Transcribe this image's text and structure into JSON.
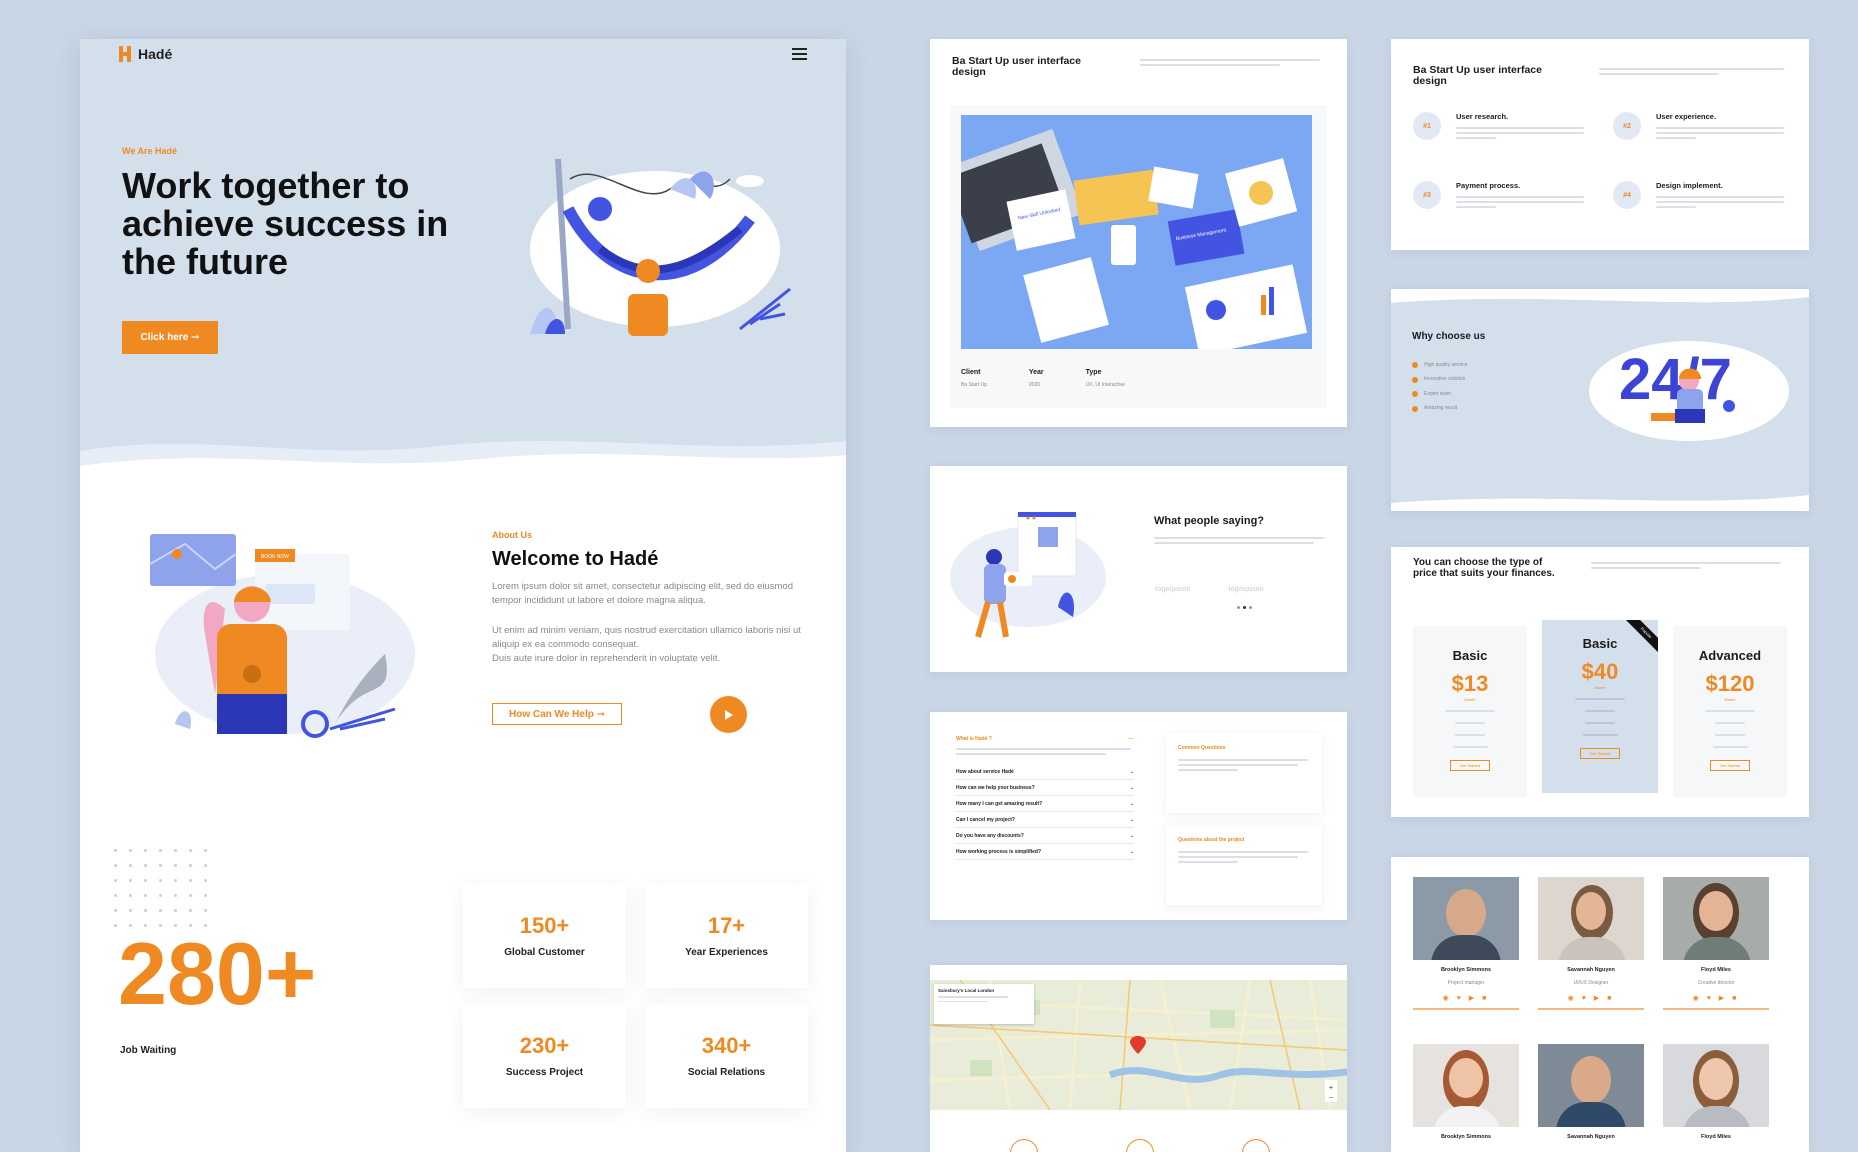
{
  "main": {
    "brand": "Hadé",
    "hero": {
      "eyebrow": "We Are Hadé",
      "title_lines": [
        "Work together to",
        "achieve success in",
        "the future"
      ],
      "cta": "Click here ➞"
    },
    "about": {
      "eyebrow": "About Us",
      "title": "Welcome to Hadé",
      "para1_lines": [
        "Lorem ipsum dolor sit amet, consectetur adipiscing elit, sed do eiusmod",
        "tempor incididunt ut labore et dolore magna aliqua."
      ],
      "para2_lines": [
        "Ut enim ad minim veniam, quis nostrud exercitation ullamco laboris nisi ut",
        "aliquip ex ea commodo consequat.",
        "Duis aute irure dolor in reprehenderit in voluptate velit."
      ],
      "help_button": "How Can We Help ➞",
      "illus_tag": "BOOK NOW"
    },
    "big_stat": {
      "value": "280+",
      "label": "Job Waiting"
    },
    "stats": [
      {
        "value": "150+",
        "label": "Global Customer"
      },
      {
        "value": "17+",
        "label": "Year Experiences"
      },
      {
        "value": "230+",
        "label": "Success Project"
      },
      {
        "value": "340+",
        "label": "Social Relations"
      }
    ]
  },
  "portfolio": {
    "title_lines": [
      "Ba Start Up user interface",
      "design"
    ],
    "meta": [
      {
        "label": "Client",
        "value": "Ba Start Up"
      },
      {
        "label": "Year",
        "value": "2020"
      },
      {
        "label": "Type",
        "value": "UX, UI Interactive"
      }
    ],
    "illus_texts": [
      "New Skill Unlocked",
      "Business Management"
    ]
  },
  "testimonial": {
    "title": "What people saying?",
    "logos": [
      "logoipsum",
      "logoipsum"
    ]
  },
  "faq": {
    "header": "What is Hadé ?",
    "header_icon": "—",
    "questions": [
      "How about service Hadé",
      "How can we help your business?",
      "How many I can get amazing result?",
      "Can I cancel my project?",
      "Do you have any discounts?",
      "How working process is simplified?"
    ],
    "side_cards": [
      "Common Questions",
      "Questions about the project"
    ]
  },
  "process": {
    "title_lines": [
      "Ba Start Up user interface",
      "design"
    ],
    "items": [
      {
        "num": "#1",
        "title": "User research."
      },
      {
        "num": "#2",
        "title": "User experience."
      },
      {
        "num": "#3",
        "title": "Payment process."
      },
      {
        "num": "#4",
        "title": "Design implement."
      }
    ]
  },
  "why": {
    "title": "Why choose us",
    "items": [
      "High quality service",
      "Innovative solution",
      "Expert team",
      "Amazing result"
    ],
    "graphic": "24/7"
  },
  "pricing": {
    "title_lines": [
      "You can choose the type of",
      "price that suits your finances."
    ],
    "plans": [
      {
        "name": "Basic",
        "price": "$13",
        "period": "Month",
        "button": "Get Started"
      },
      {
        "name": "Basic",
        "price": "$40",
        "period": "Month",
        "button": "Get Started"
      },
      {
        "name": "Advanced",
        "price": "$120",
        "period": "Month",
        "button": "Get Started"
      }
    ],
    "ribbon": "Popular"
  },
  "team": {
    "members": [
      {
        "name": "Brooklyn Simmons",
        "role": "Project manager"
      },
      {
        "name": "Savannah Nguyen",
        "role": "UI/UX Designer"
      },
      {
        "name": "Floyd Miles",
        "role": "Creative director"
      },
      {
        "name": "Brooklyn Simmons",
        "role": ""
      },
      {
        "name": "Savannah Nguyen",
        "role": ""
      },
      {
        "name": "Floyd Miles",
        "role": ""
      }
    ],
    "social": "◉ ♥ ▶ ■"
  },
  "map": {
    "place_title": "Sainsbury's Local London",
    "pin_icon": "location-pin-icon"
  },
  "colors": {
    "accent": "#ef8a22",
    "bg": "#c9d6e6",
    "hero_bg": "#d4dfec",
    "illus_blue": "#4354e3"
  }
}
